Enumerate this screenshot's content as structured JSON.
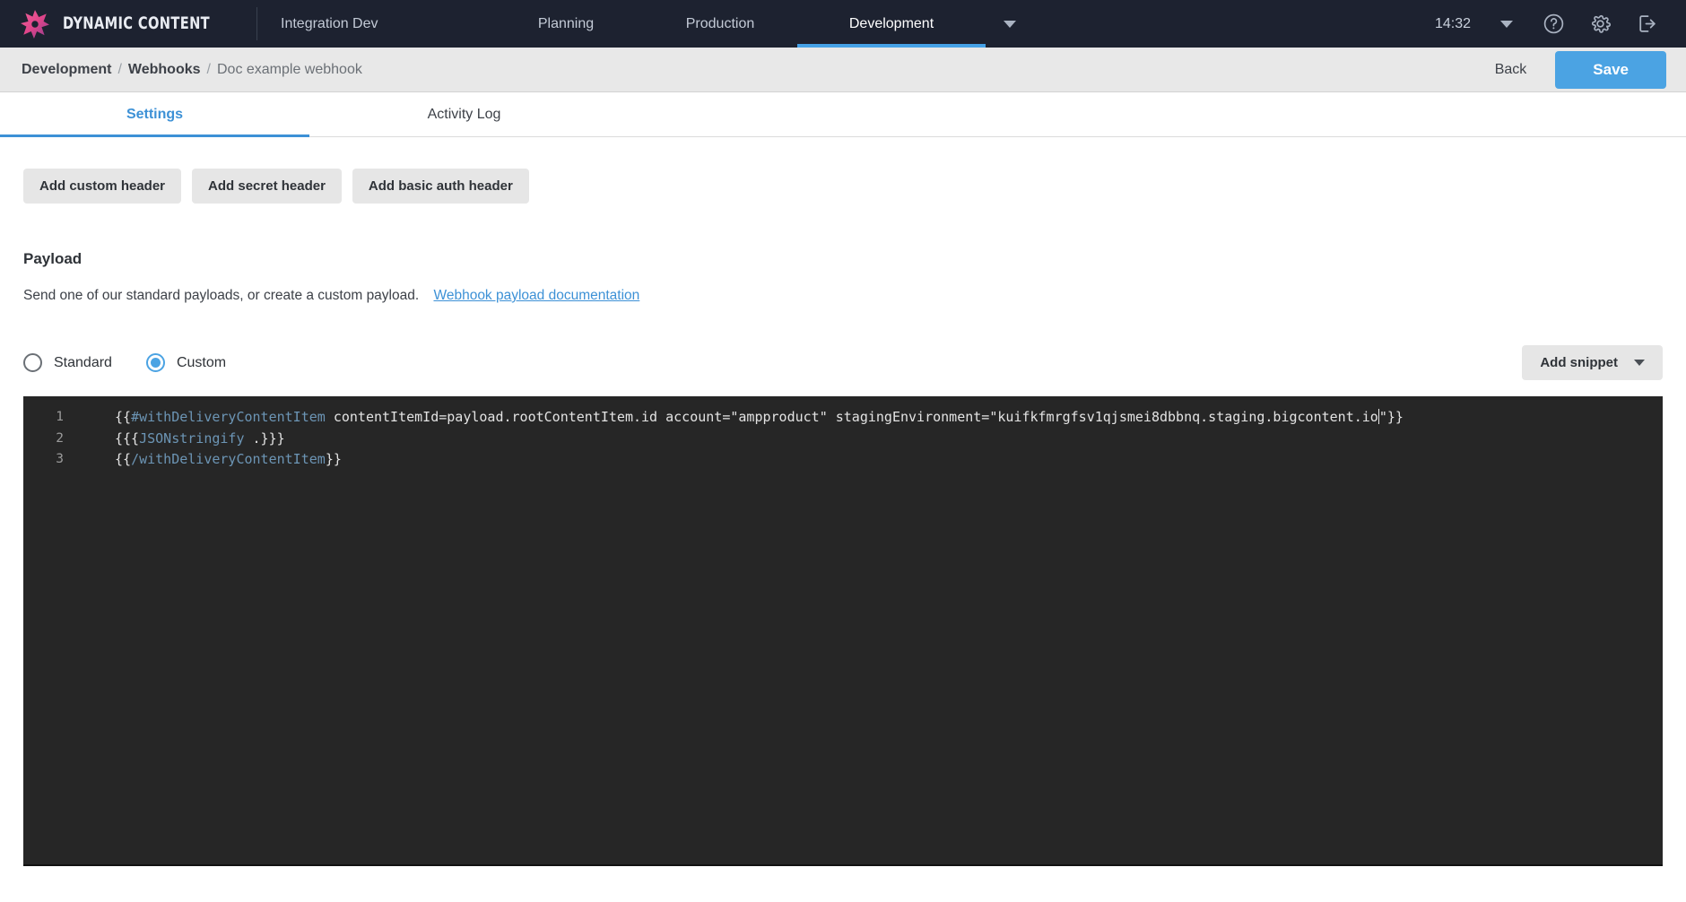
{
  "topbar": {
    "brand": "DYNAMIC CONTENT",
    "logo_icon": "starburst-logo-icon",
    "nav": [
      {
        "label": "Integration Dev",
        "active": false
      },
      {
        "label": "Planning",
        "active": false
      },
      {
        "label": "Production",
        "active": false
      },
      {
        "label": "Development",
        "active": true
      }
    ],
    "nav_caret_icon": "chevron-down-icon",
    "clock": "14:32",
    "user_caret_icon": "chevron-down-icon",
    "help_icon": "help-circle-icon",
    "settings_icon": "gear-icon",
    "logout_icon": "logout-icon",
    "accent": "#45a1e6",
    "background": "#1d2230"
  },
  "breadcrumb": {
    "items": [
      "Development",
      "Webhooks"
    ],
    "separator": "/",
    "current": "Doc example webhook",
    "back_label": "Back",
    "save_label": "Save",
    "save_color": "#4ba3e3"
  },
  "tabs": [
    {
      "label": "Settings",
      "active": true
    },
    {
      "label": "Activity Log",
      "active": false
    }
  ],
  "header_buttons": [
    {
      "label": "Add custom header"
    },
    {
      "label": "Add secret header"
    },
    {
      "label": "Add basic auth header"
    }
  ],
  "payload": {
    "title": "Payload",
    "description": "Send one of our standard payloads, or create a custom payload.",
    "doc_link": "Webhook payload documentation",
    "options": [
      {
        "label": "Standard",
        "selected": false
      },
      {
        "label": "Custom",
        "selected": true
      }
    ],
    "snippet_button": "Add snippet",
    "snippet_caret_icon": "chevron-down-icon"
  },
  "editor": {
    "background": "#262626",
    "helper_color": "#6c95b5",
    "text_color": "#e3e3e3",
    "line_numbers": [
      "1",
      "2",
      "3"
    ],
    "lines": [
      {
        "number": "1",
        "segments": [
          {
            "text": "{{",
            "type": "plain"
          },
          {
            "text": "#withDeliveryContentItem",
            "type": "helper"
          },
          {
            "text": " contentItemId=payload.rootContentItem.id account=\"ampproduct\" stagingEnvironment=\"kuifkfmrgfsv1qjsmei8dbbnq.staging.bigcontent.io",
            "type": "plain"
          },
          {
            "text": "CARET",
            "type": "caret"
          },
          {
            "text": "\"}}",
            "type": "plain"
          }
        ]
      },
      {
        "number": "2",
        "segments": [
          {
            "text": "{{{",
            "type": "plain"
          },
          {
            "text": "JSONstringify",
            "type": "helper"
          },
          {
            "text": " .}}}",
            "type": "plain"
          }
        ]
      },
      {
        "number": "3",
        "segments": [
          {
            "text": "{{",
            "type": "plain"
          },
          {
            "text": "/withDeliveryContentItem",
            "type": "helper"
          },
          {
            "text": "}}",
            "type": "plain"
          }
        ]
      }
    ]
  }
}
